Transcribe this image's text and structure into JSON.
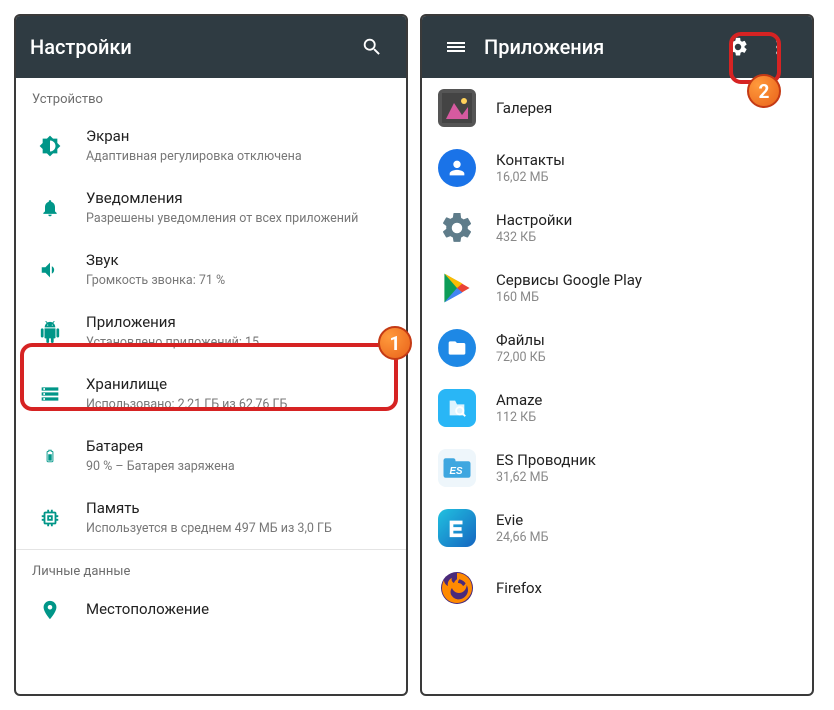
{
  "left": {
    "app_title": "Настройки",
    "section1": "Устройство",
    "items": [
      {
        "title": "Экран",
        "sub": "Адаптивная регулировка отключена"
      },
      {
        "title": "Уведомления",
        "sub": "Разрешены уведомления от всех приложений"
      },
      {
        "title": "Звук",
        "sub": "Громкость звонка: 71 %"
      },
      {
        "title": "Приложения",
        "sub": "Установлено приложений: 15"
      },
      {
        "title": "Хранилище",
        "sub": "Использовано: 2,21 ГБ из 62,76 ГБ"
      },
      {
        "title": "Батарея",
        "sub": "90 % – Батарея заряжена"
      },
      {
        "title": "Память",
        "sub": "Используется в среднем 497 МБ из 3,0 ГБ"
      }
    ],
    "section2": "Личные данные",
    "items2": [
      {
        "title": "Местоположение",
        "sub": ""
      }
    ]
  },
  "right": {
    "app_title": "Приложения",
    "apps": [
      {
        "name": "Галерея",
        "size": ""
      },
      {
        "name": "Контакты",
        "size": "16,02 МБ"
      },
      {
        "name": "Настройки",
        "size": "432 КБ"
      },
      {
        "name": "Сервисы Google Play",
        "size": "160 МБ"
      },
      {
        "name": "Файлы",
        "size": "72,00 КБ"
      },
      {
        "name": "Amaze",
        "size": "112 КБ"
      },
      {
        "name": "ES Проводник",
        "size": "31,62 МБ"
      },
      {
        "name": "Evie",
        "size": "24,66 МБ"
      },
      {
        "name": "Firefox",
        "size": ""
      }
    ]
  },
  "callouts": {
    "b1": "1",
    "b2": "2"
  }
}
